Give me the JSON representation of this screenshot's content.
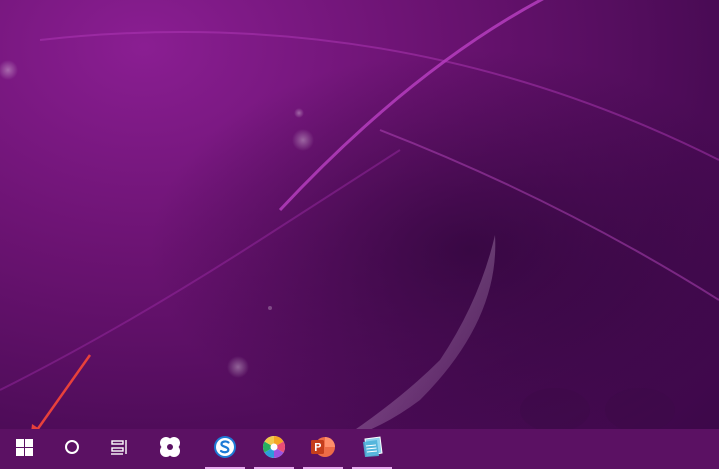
{
  "taskbar": {
    "color": "#5b1163",
    "buttons": [
      {
        "name": "start",
        "icon": "windows-logo-icon",
        "active": false
      },
      {
        "name": "search",
        "icon": "cortana-circle-icon",
        "active": false
      },
      {
        "name": "task-view",
        "icon": "task-view-icon",
        "active": false
      },
      {
        "name": "flower-app",
        "icon": "flower-app-icon",
        "active": false
      },
      {
        "name": "sogou-browser",
        "icon": "sogou-browser-icon",
        "active": true
      },
      {
        "name": "color-app",
        "icon": "color-wheel-app-icon",
        "active": true
      },
      {
        "name": "powerpoint",
        "icon": "powerpoint-icon",
        "active": true
      },
      {
        "name": "notepad-app",
        "icon": "notepad-app-icon",
        "active": true
      }
    ],
    "indicator_color": "#e6a9ee"
  },
  "wallpaper": {
    "theme": "purple abstract",
    "accent": "#8a1e92"
  },
  "annotation": {
    "arrow_color": "#e8413b",
    "points_to": "start-button"
  }
}
